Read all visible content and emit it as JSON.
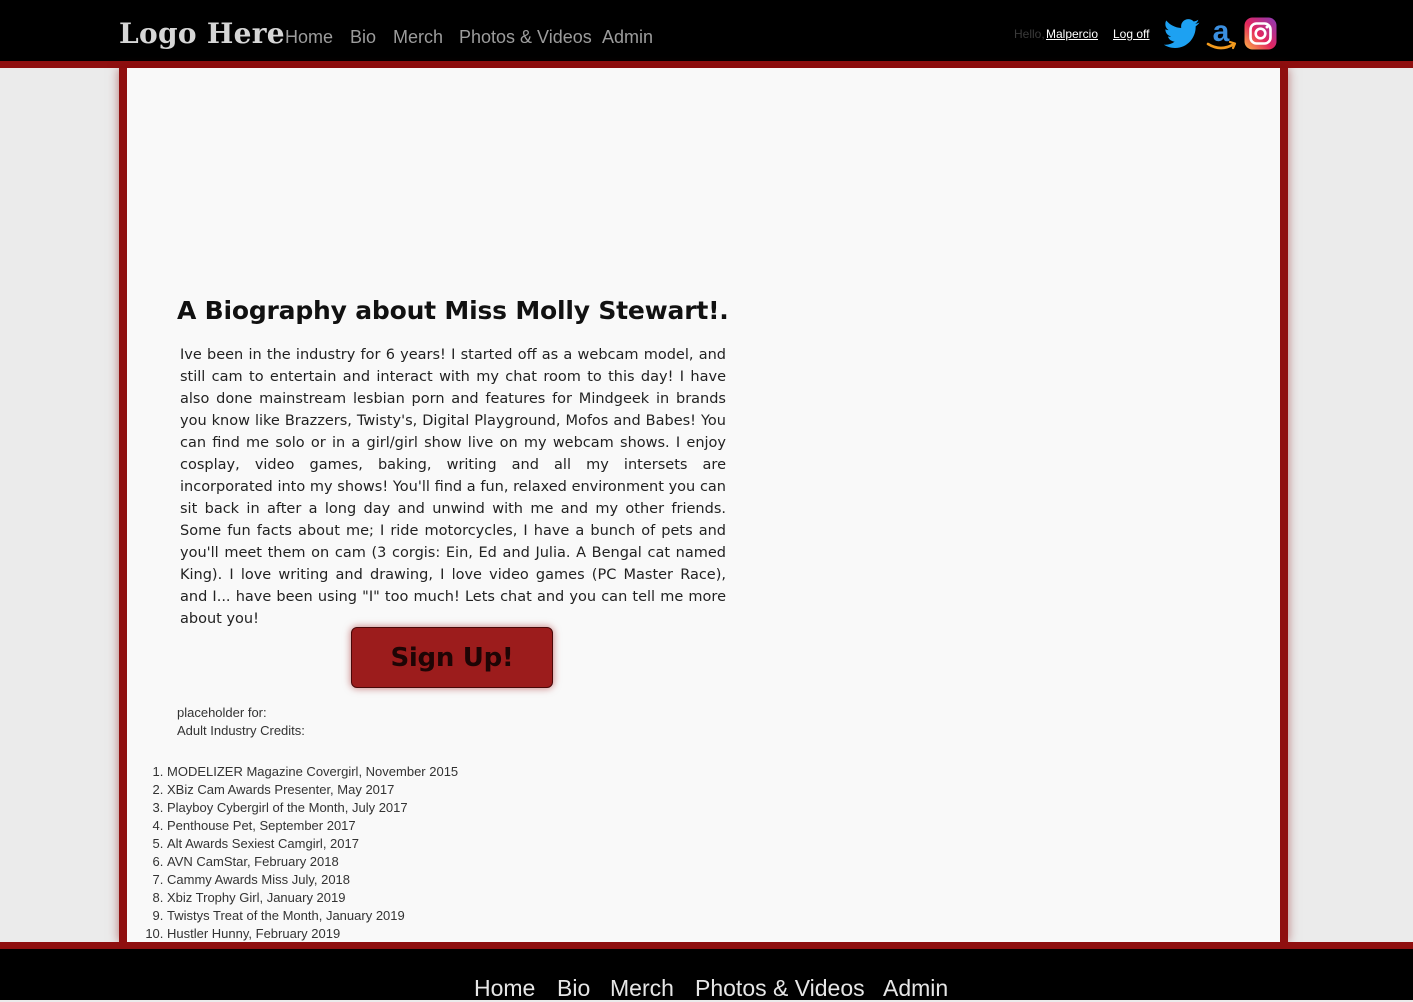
{
  "header": {
    "logo": "Logo Here",
    "nav": [
      "Home",
      "Bio",
      "Merch",
      "Photos & Videos",
      "Admin"
    ],
    "greeting": "Hello,",
    "username": "Malpercio",
    "logoff": "Log off",
    "social_icons": [
      "twitter-icon",
      "amazon-icon",
      "instagram-icon"
    ]
  },
  "bio": {
    "title": "A Biography about Miss Molly Stewart!.",
    "text": "Ive been in the industry for 6 years! I started off as a webcam model, and still cam to entertain and interact with my chat room to this day! I have also done mainstream lesbian porn and features for Mindgeek in brands you know like Brazzers, Twisty's, Digital Playground, Mofos and Babes! You can find me solo or in a girl/girl show live on my webcam shows. I enjoy cosplay, video games, baking, writing and all my intersets are incorporated into my shows! You'll find a fun, relaxed environment you can sit back in after a long day and unwind with me and my other friends. Some fun facts about me; I ride motorcycles, I have a bunch of pets and you'll meet them on cam (3 corgis: Ein, Ed and Julia. A Bengal cat named King). I love writing and drawing, I love video games (PC Master Race), and I... have been using \"I\" too much! Lets chat and you can tell me more about you!",
    "signup_label": "Sign Up!"
  },
  "credits": {
    "placeholder_line1": "placeholder for:",
    "placeholder_line2": "Adult Industry Credits:",
    "items": [
      "MODELIZER Magazine Covergirl, November 2015",
      "XBiz Cam Awards Presenter, May 2017",
      "Playboy Cybergirl of the Month, July 2017",
      "Penthouse Pet, September 2017",
      "Alt Awards Sexiest Camgirl, 2017",
      "AVN CamStar, February 2018",
      "Cammy Awards Miss July, 2018",
      "Xbiz Trophy Girl, January 2019",
      "Twistys Treat of the Month, January 2019",
      "Hustler Hunny, February 2019"
    ]
  },
  "footer": {
    "nav": [
      "Home",
      "Bio",
      "Merch",
      "Photos & Videos",
      "Admin"
    ]
  },
  "colors": {
    "accent_red": "#8f0f0f",
    "button_red": "#9c1c1c",
    "topbar": "#000000",
    "panel": "#f9f9f9"
  }
}
